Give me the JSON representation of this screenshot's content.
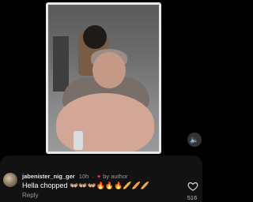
{
  "comment": {
    "username": "jabenister_nig_ger",
    "time": "10h",
    "separator": "·",
    "author_heart_icon": "♥",
    "author_label": "by author",
    "text": "Hella chopped 👐🏼👐🏼👐🏼🔥🔥🔥🥖🥖🥖",
    "reply_label": "Reply",
    "like_count": "516"
  },
  "video": {
    "mute_icon": "🔈"
  },
  "colors": {
    "panel_bg": "#121212",
    "author_heart": "#ff2d55"
  }
}
